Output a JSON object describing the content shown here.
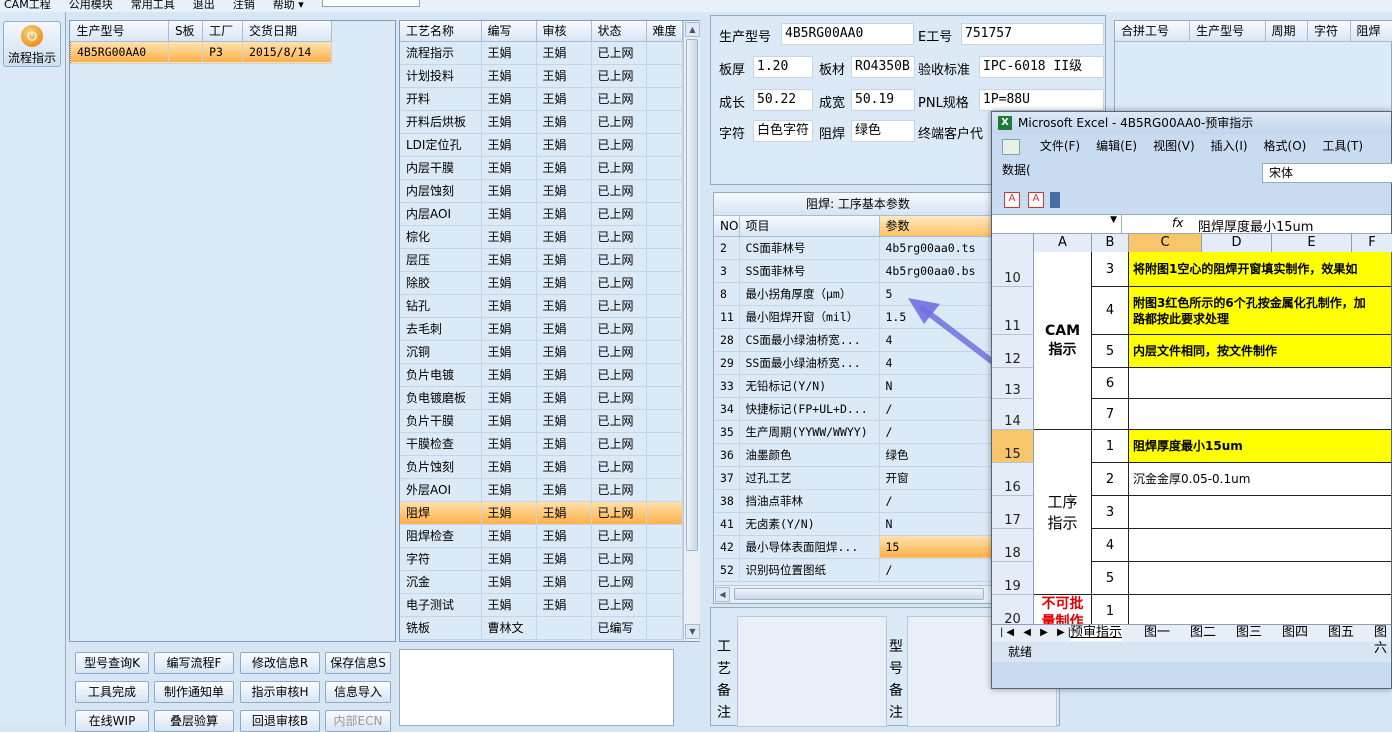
{
  "menubar": {
    "items": [
      "CAM工程",
      "公用模块",
      "常用工具",
      "退出",
      "注销",
      "帮助 ▾"
    ]
  },
  "sidebar": {
    "button_label": "流程指示",
    "button_glyph": "⏻"
  },
  "orders": {
    "headers": [
      "生产型号",
      "S板",
      "工厂",
      "交货日期"
    ],
    "rows": [
      {
        "model": "4B5RG00AA0",
        "s": "",
        "factory": "P3",
        "date": "2015/8/14"
      }
    ]
  },
  "process": {
    "headers": [
      "工艺名称",
      "编写",
      "审核",
      "状态",
      "难度"
    ],
    "rows": [
      [
        "流程指示",
        "王娟",
        "王娟",
        "已上网",
        ""
      ],
      [
        "计划投料",
        "王娟",
        "王娟",
        "已上网",
        ""
      ],
      [
        "开料",
        "王娟",
        "王娟",
        "已上网",
        ""
      ],
      [
        "开料后烘板",
        "王娟",
        "王娟",
        "已上网",
        ""
      ],
      [
        "LDI定位孔",
        "王娟",
        "王娟",
        "已上网",
        ""
      ],
      [
        "内层干膜",
        "王娟",
        "王娟",
        "已上网",
        ""
      ],
      [
        "内层蚀刻",
        "王娟",
        "王娟",
        "已上网",
        ""
      ],
      [
        "内层AOI",
        "王娟",
        "王娟",
        "已上网",
        ""
      ],
      [
        "棕化",
        "王娟",
        "王娟",
        "已上网",
        ""
      ],
      [
        "层压",
        "王娟",
        "王娟",
        "已上网",
        ""
      ],
      [
        "除胶",
        "王娟",
        "王娟",
        "已上网",
        ""
      ],
      [
        "钻孔",
        "王娟",
        "王娟",
        "已上网",
        ""
      ],
      [
        "去毛刺",
        "王娟",
        "王娟",
        "已上网",
        ""
      ],
      [
        "沉铜",
        "王娟",
        "王娟",
        "已上网",
        ""
      ],
      [
        "负片电镀",
        "王娟",
        "王娟",
        "已上网",
        ""
      ],
      [
        "负电镀磨板",
        "王娟",
        "王娟",
        "已上网",
        ""
      ],
      [
        "负片干膜",
        "王娟",
        "王娟",
        "已上网",
        ""
      ],
      [
        "干膜检查",
        "王娟",
        "王娟",
        "已上网",
        ""
      ],
      [
        "负片蚀刻",
        "王娟",
        "王娟",
        "已上网",
        ""
      ],
      [
        "外层AOI",
        "王娟",
        "王娟",
        "已上网",
        ""
      ],
      [
        "阻焊",
        "王娟",
        "王娟",
        "已上网",
        ""
      ],
      [
        "阻焊检查",
        "王娟",
        "王娟",
        "已上网",
        ""
      ],
      [
        "字符",
        "王娟",
        "王娟",
        "已上网",
        ""
      ],
      [
        "沉金",
        "王娟",
        "王娟",
        "已上网",
        ""
      ],
      [
        "电子测试",
        "王娟",
        "王娟",
        "已上网",
        ""
      ],
      [
        "铣板",
        "曹林文",
        "",
        "已编写",
        ""
      ]
    ],
    "selected_index": 20
  },
  "buttons": [
    [
      "型号查询K",
      "编写流程F",
      "修改信息R",
      "保存信息S"
    ],
    [
      "工具完成",
      "制作通知单",
      "指示审核H",
      "信息导入"
    ],
    [
      "在线WIP",
      "叠层验算",
      "回退审核B",
      "内部ECN"
    ]
  ],
  "info": {
    "model_label": "生产型号",
    "model": "4B5RG00AA0",
    "eno_label": "E工号",
    "eno": "751757",
    "thick_label": "板厚",
    "thick": "1.20",
    "mat_label": "板材",
    "mat": "RO4350B",
    "std_label": "验收标准",
    "std": "IPC-6018 II级",
    "len_label": "成长",
    "len": "50.22",
    "wid_label": "成宽",
    "wid": "50.19",
    "pnl_label": "PNL规格",
    "pnl": "1P=88U",
    "char_label": "字符",
    "char": "白色字符",
    "mask_label": "阻焊",
    "mask": "绿色",
    "cust_label": "终端客户代"
  },
  "merge": {
    "headers": [
      "合拼工号",
      "生产型号",
      "周期",
      "字符",
      "阻焊"
    ]
  },
  "params": {
    "title": "阻焊: 工序基本参数",
    "headers": [
      "NO",
      "项目",
      "参数"
    ],
    "rows": [
      [
        "2",
        "CS面菲林号",
        "4b5rg00aa0.ts"
      ],
      [
        "3",
        "SS面菲林号",
        "4b5rg00aa0.bs"
      ],
      [
        "8",
        "最小拐角厚度（μm）",
        "5"
      ],
      [
        "11",
        "最小阻焊开窗（mil）",
        "1.5"
      ],
      [
        "28",
        "CS面最小绿油桥宽...",
        "4"
      ],
      [
        "29",
        "SS面最小绿油桥宽...",
        "4"
      ],
      [
        "33",
        "无铅标记(Y/N)",
        "N"
      ],
      [
        "34",
        "快捷标记(FP+UL+D...",
        "/"
      ],
      [
        "35",
        "生产周期(YYWW/WWYY)",
        "/"
      ],
      [
        "36",
        "油墨颜色",
        "绿色"
      ],
      [
        "37",
        "过孔工艺",
        "开窗"
      ],
      [
        "38",
        "挡油点菲林",
        "/"
      ],
      [
        "41",
        "无卤素(Y/N)",
        "N"
      ],
      [
        "42",
        "最小导体表面阻焊...",
        "15"
      ],
      [
        "52",
        "识别码位置图纸",
        "/"
      ]
    ],
    "selected_index": 13
  },
  "notes": {
    "process_label": "工艺备注",
    "model_label": "型号备注"
  },
  "excel": {
    "title": "Microsoft Excel - 4B5RG00AA0-预审指示",
    "menus": [
      "文件(F)",
      "编辑(E)",
      "视图(V)",
      "插入(I)",
      "格式(O)",
      "工具(T)",
      "数据("
    ],
    "font": "宋体",
    "formula": "阻焊厚度最小15um",
    "fx": "fx",
    "columns": [
      "A",
      "B",
      "C",
      "D",
      "E",
      "F"
    ],
    "rows": [
      {
        "num": "10",
        "b": "3",
        "c": "将附图1空心的阻焊开窗填实制作，效果如",
        "ylw": true
      },
      {
        "num": "11",
        "b": "4",
        "c": "附图3红色所示的6个孔按金属化孔制作，加\n路都按此要求处理",
        "ylw": true
      },
      {
        "num": "12",
        "b": "5",
        "c": "内层文件相同，按文件制作",
        "ylw": true
      },
      {
        "num": "13",
        "b": "6",
        "c": "",
        "ylw": false
      },
      {
        "num": "14",
        "b": "7",
        "c": "",
        "ylw": false
      },
      {
        "num": "15",
        "b": "1",
        "c": "阻焊厚度最小15um",
        "ylw": true
      },
      {
        "num": "16",
        "b": "2",
        "c": "沉金金厚0.05-0.1um",
        "ylw": false
      },
      {
        "num": "17",
        "b": "3",
        "c": "",
        "ylw": false
      },
      {
        "num": "18",
        "b": "4",
        "c": "",
        "ylw": false
      },
      {
        "num": "19",
        "b": "5",
        "c": "",
        "ylw": false
      },
      {
        "num": "20",
        "b": "1",
        "c": "",
        "ylw": false
      }
    ],
    "group_cam": "CAM\n指示",
    "group_proc": "工序\n指示",
    "group_batch": "不可批\n量制作",
    "sheets": [
      "预审指示",
      "图一",
      "图二",
      "图三",
      "图四",
      "图五",
      "图六",
      "图"
    ],
    "status": "就绪"
  }
}
